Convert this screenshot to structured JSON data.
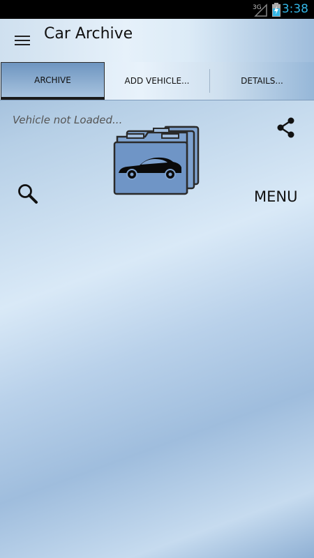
{
  "status_bar": {
    "network_label": "3G",
    "time": "3:38",
    "icons": [
      "signal-icon",
      "battery-icon"
    ]
  },
  "action_bar": {
    "title": "Car Archive",
    "menu_icon": "hamburger-menu-icon"
  },
  "tabs": [
    {
      "label": "ARCHIVE",
      "active": true
    },
    {
      "label": "ADD VEHICLE..."
    },
    {
      "label": "DETAILS..."
    }
  ],
  "content": {
    "vehicle_status": "Vehicle not Loaded...",
    "menu_label": "MENU",
    "icons": [
      "share-icon",
      "car-archive-icon",
      "search-icon"
    ]
  },
  "colors": {
    "status_time": "#33b5e5",
    "active_tab": "#6e95c0"
  }
}
